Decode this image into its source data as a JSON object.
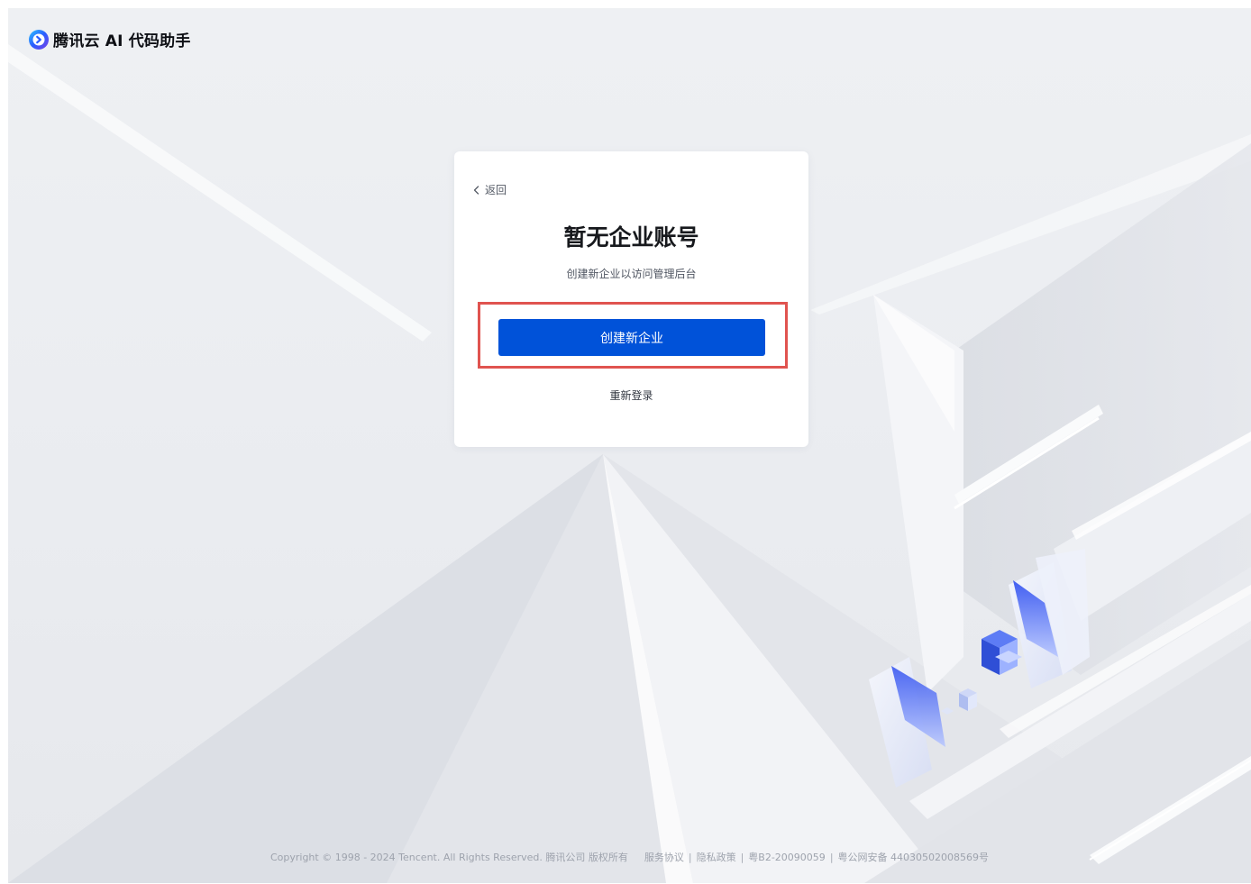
{
  "header": {
    "brand_name": "腾讯云 AI 代码助手",
    "logo_icon": "tencent-cloud-logo-icon",
    "brand_colors": [
      "#2a5cff",
      "#7b3fe4",
      "#2ec7ff"
    ]
  },
  "card": {
    "back_label": "返回",
    "back_icon": "chevron-left-icon",
    "title": "暂无企业账号",
    "subtitle": "创建新企业以访问管理后台",
    "primary_button_label": "创建新企业",
    "secondary_link_label": "重新登录"
  },
  "footer": {
    "copyright": "Copyright © 1998 - 2024 Tencent. All Rights Reserved. 腾讯公司 版权所有",
    "links": [
      {
        "label": "服务协议"
      },
      {
        "label": "隐私政策"
      },
      {
        "label": "粤B2-20090059"
      },
      {
        "label": "粤公网安备 44030502008569号"
      }
    ],
    "separator": "|"
  },
  "colors": {
    "primary": "#0052d9",
    "highlight": "#e0534f",
    "background": "#eceef2"
  }
}
